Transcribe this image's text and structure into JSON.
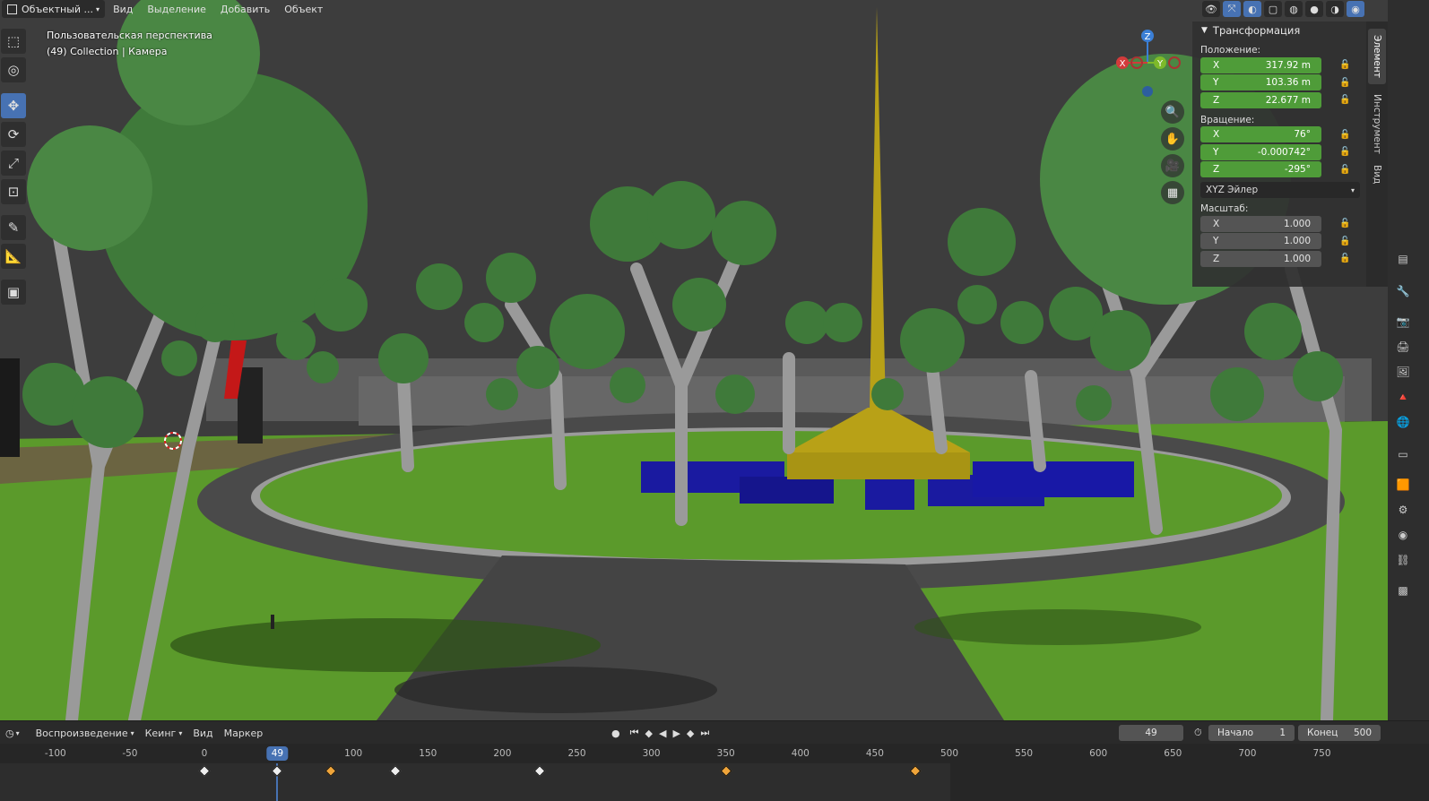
{
  "header": {
    "mode_label": "Объектный ...",
    "menu": [
      "Вид",
      "Выделение",
      "Добавить",
      "Объект"
    ]
  },
  "viewport": {
    "perspective_label": "Пользовательская перспектива",
    "collection_label": "(49) Collection | Камера"
  },
  "gizmo": {
    "x_label": "X",
    "y_label": "Y",
    "z_label": "Z"
  },
  "toolbar": {
    "tools": [
      "select-box",
      "cursor",
      "move",
      "rotate",
      "scale",
      "transform",
      "annotate",
      "measure",
      "add-cube"
    ]
  },
  "transform_panel": {
    "title": "Трансформация",
    "location_label": "Положение:",
    "location": {
      "x": "317.92 m",
      "y": "103.36 m",
      "z": "22.677 m"
    },
    "rotation_label": "Вращение:",
    "rotation": {
      "x": "76°",
      "y": "-0.000742°",
      "z": "-295°"
    },
    "rotation_mode": "XYZ Эйлер",
    "scale_label": "Масштаб:",
    "scale": {
      "x": "1.000",
      "y": "1.000",
      "z": "1.000"
    },
    "axis_labels": {
      "x": "X",
      "y": "Y",
      "z": "Z"
    }
  },
  "side_tabs": [
    "Элемент",
    "Инструмент",
    "Вид"
  ],
  "timeline": {
    "playback_label": "Воспроизведение",
    "keying_label": "Кеинг",
    "view_label": "Вид",
    "marker_label": "Маркер",
    "current_frame": "49",
    "start_label": "Начало",
    "start_value": "1",
    "end_label": "Конец",
    "end_value": "500",
    "ruler_ticks": [
      "-100",
      "-50",
      "0",
      "100",
      "150",
      "200",
      "250",
      "300",
      "350",
      "400",
      "450",
      "500",
      "550",
      "600",
      "650",
      "700",
      "750"
    ],
    "playhead_label": "49",
    "keyframes": [
      0,
      49,
      85,
      128,
      225,
      350,
      477
    ],
    "selected_keyframes": [
      85,
      350,
      477
    ]
  },
  "colors": {
    "sky": "#3c3c3c",
    "grass": "#5c9a2a",
    "foliage": "#3f7a3a",
    "trunk": "#9a9a9a",
    "path": "#4a4a4a",
    "monument": "#b19a14",
    "blocks": "#1a1aa0",
    "accent": "#4772b3",
    "field_green": "#4f9c39"
  }
}
